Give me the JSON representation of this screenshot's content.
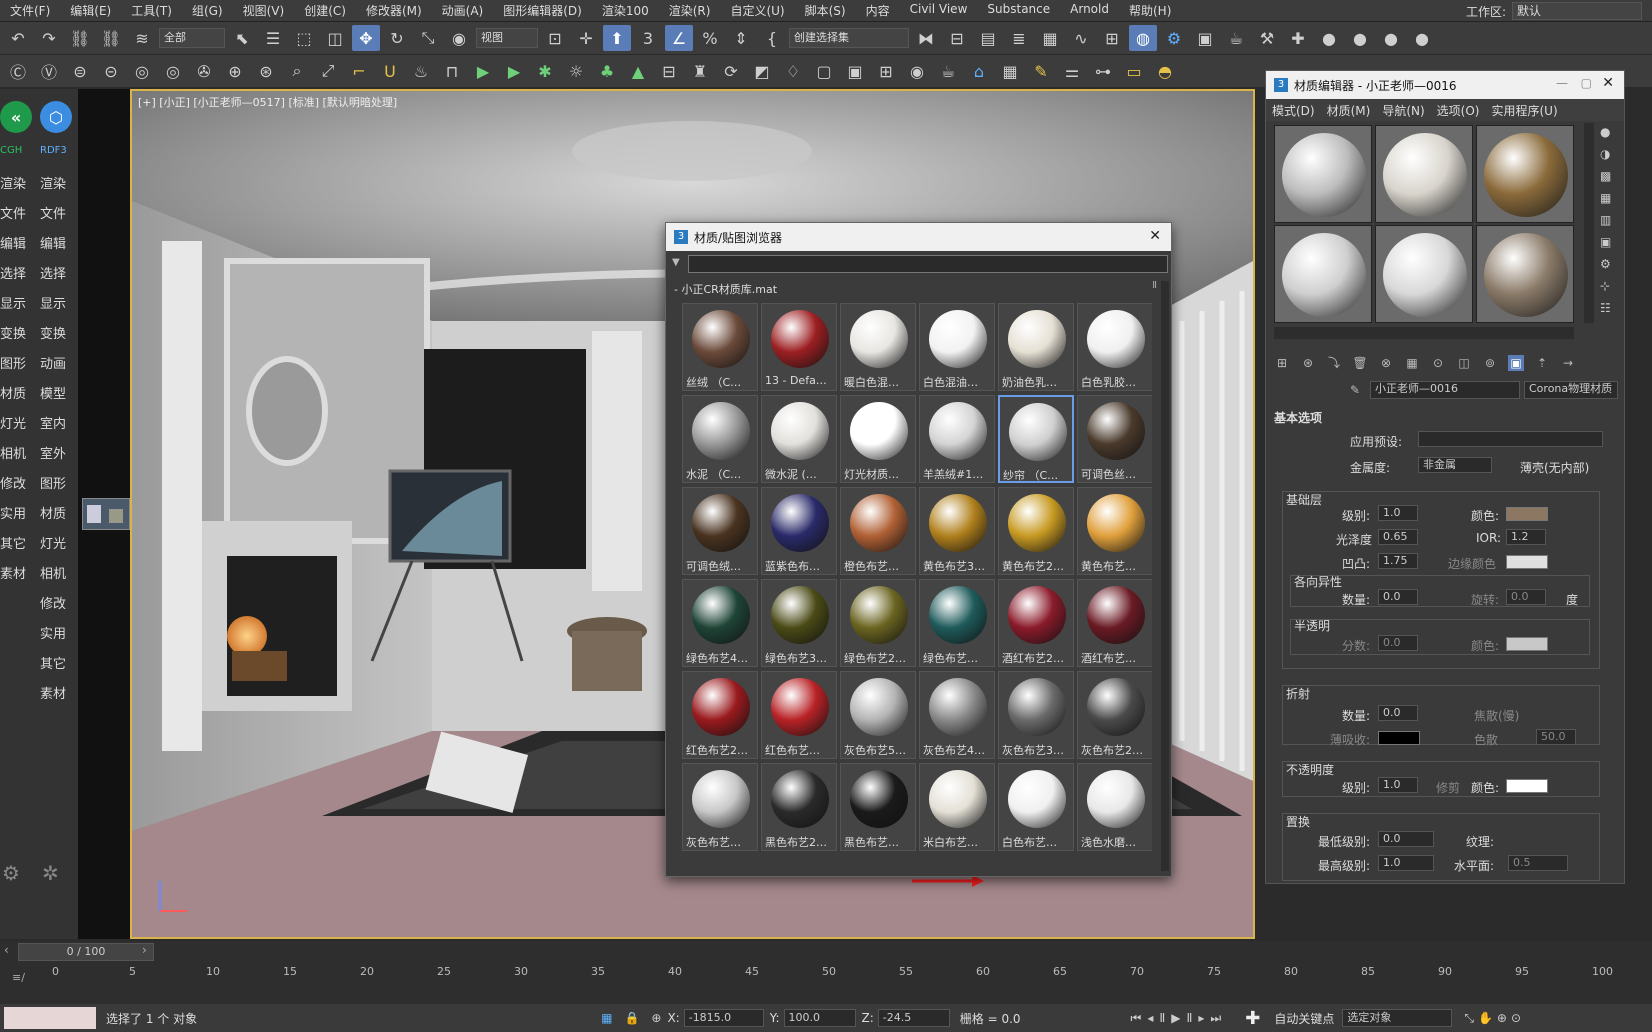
{
  "menus": [
    "文件(F)",
    "编辑(E)",
    "工具(T)",
    "组(G)",
    "视图(V)",
    "创建(C)",
    "修改器(M)",
    "动画(A)",
    "图形编辑器(D)",
    "渲染100",
    "渲染(R)",
    "自定义(U)",
    "脚本(S)",
    "内容",
    "Civil View",
    "Substance",
    "Arnold",
    "帮助(H)"
  ],
  "workspace": {
    "label": "工作区:",
    "value": "默认"
  },
  "toolbar": {
    "filter_select": "全部",
    "view_select": "视图",
    "selection_set": "创建选择集",
    "snap_label": "3"
  },
  "left_panel": {
    "logos": [
      "CGH",
      "RDF3"
    ],
    "col1": [
      "渲染",
      "文件",
      "编辑",
      "选择",
      "显示",
      "变换",
      "图形",
      "材质",
      "灯光",
      "相机",
      "修改",
      "实用",
      "其它",
      "素材"
    ],
    "col2": [
      "渲染",
      "文件",
      "编辑",
      "选择",
      "显示",
      "变换",
      "动画",
      "模型",
      "室内",
      "室外",
      "图形",
      "材质",
      "灯光",
      "相机",
      "修改",
      "实用",
      "其它",
      "素材"
    ]
  },
  "viewport": {
    "label": "[+] [小正] [小正老师—0517] [标准] [默认明暗处理]"
  },
  "browser": {
    "title": "材质/贴图浏览器",
    "library": "- 小正CR材质库.mat",
    "materials": [
      {
        "name": "丝绒 （C…",
        "color": "#6b4a3a"
      },
      {
        "name": "13 - Defa…",
        "color": "#9c1f22"
      },
      {
        "name": "暖白色混…",
        "color": "#e8e6e2"
      },
      {
        "name": "白色混油…",
        "color": "#f2f2f2"
      },
      {
        "name": "奶油色乳…",
        "color": "#e6e0d4"
      },
      {
        "name": "白色乳胶…",
        "color": "#f0f0f0"
      },
      {
        "name": "水泥 （C…",
        "color": "#9a9a9a"
      },
      {
        "name": "微水泥 (…",
        "color": "#e2e0dc"
      },
      {
        "name": "灯光材质…",
        "color": "#ffffff"
      },
      {
        "name": "羊羔绒#1…",
        "color": "#d4d4d4"
      },
      {
        "name": "纱帘 （C…",
        "color": "#cfcfcf"
      },
      {
        "name": "可调色丝…",
        "color": "#4a3a2c"
      },
      {
        "name": "可调色绒…",
        "color": "#4a3320"
      },
      {
        "name": "蓝紫色布…",
        "color": "#2a2a6a"
      },
      {
        "name": "橙色布艺…",
        "color": "#b06034"
      },
      {
        "name": "黄色布艺3…",
        "color": "#b0801c"
      },
      {
        "name": "黄色布艺2…",
        "color": "#c79a22"
      },
      {
        "name": "黄色布艺…",
        "color": "#e0a03c"
      },
      {
        "name": "绿色布艺4…",
        "color": "#1e4436"
      },
      {
        "name": "绿色布艺3…",
        "color": "#4a4a16"
      },
      {
        "name": "绿色布艺2…",
        "color": "#6a6420"
      },
      {
        "name": "绿色布艺…",
        "color": "#1e5a5a"
      },
      {
        "name": "酒红布艺2…",
        "color": "#8a1a2a"
      },
      {
        "name": "酒红布艺…",
        "color": "#6a1a24"
      },
      {
        "name": "红色布艺2…",
        "color": "#9a1a1e"
      },
      {
        "name": "红色布艺…",
        "color": "#b82226"
      },
      {
        "name": "灰色布艺5…",
        "color": "#b4b4b4"
      },
      {
        "name": "灰色布艺4…",
        "color": "#8a8a8a"
      },
      {
        "name": "灰色布艺3…",
        "color": "#6a6a6a"
      },
      {
        "name": "灰色布艺2…",
        "color": "#4a4a4a"
      },
      {
        "name": "灰色布艺…",
        "color": "#c8c8c8"
      },
      {
        "name": "黑色布艺2…",
        "color": "#2a2a2a"
      },
      {
        "name": "黑色布艺…",
        "color": "#1a1a1a"
      },
      {
        "name": "米白布艺…",
        "color": "#e4e0d6"
      },
      {
        "name": "白色布艺…",
        "color": "#f0f0f0"
      },
      {
        "name": "浅色水磨…",
        "color": "#e8e8e8"
      }
    ],
    "selected_index": 10
  },
  "editor": {
    "title": "材质编辑器 - 小正老师—0016",
    "menus": [
      "模式(D)",
      "材质(M)",
      "导航(N)",
      "选项(O)",
      "实用程序(U)"
    ],
    "samples": [
      "#bdbdbd",
      "#d8d4cc",
      "#8a6a3a",
      "#cfcfcf",
      "#d8d8d8",
      "#8a7a68"
    ],
    "material_name": "小正老师—0016",
    "material_type": "Corona物理材质",
    "section_basic": "基本选项",
    "preset_label": "应用预设:",
    "metal_label": "金属度:",
    "metal_value": "非金属",
    "thin_label": "薄壳(无内部)",
    "base_layer": "基础层",
    "level_label": "级别:",
    "level_value": "1.0",
    "color_label": "颜色:",
    "base_color": "#8c7862",
    "gloss_label": "光泽度",
    "gloss_value": "0.65",
    "ior_label": "IOR:",
    "ior_value": "1.2",
    "bump_label": "凹凸:",
    "bump_value": "1.75",
    "edge_color_label": "边缘颜色",
    "aniso": "各向异性",
    "aniso_amount_label": "数量:",
    "aniso_amount": "0.0",
    "rotate_label": "旋转:",
    "rotate_value": "0.0",
    "degree": "度",
    "translucency": "半透明",
    "fraction_label": "分数:",
    "fraction_value": "0.0",
    "trans_color_label": "颜色:",
    "refraction": "折射",
    "refr_amount_label": "数量:",
    "refr_amount": "0.0",
    "caustics": "焦散(慢)",
    "thin_absorb": "薄吸收:",
    "dispersion": "色散",
    "abbe": "50.0",
    "opacity": "不透明度",
    "op_level_label": "级别:",
    "op_level": "1.0",
    "clip": "修剪",
    "op_color_label": "颜色:",
    "displacement": "置换",
    "min_level_label": "最低级别:",
    "min_level": "0.0",
    "texture_label": "纹理:",
    "max_level_label": "最高级别:",
    "max_level": "1.0",
    "water_label": "水平面:",
    "water_value": "0.5"
  },
  "timeline": {
    "frame": "0 / 100",
    "ticks": [
      "0",
      "5",
      "10",
      "15",
      "20",
      "25",
      "30",
      "35",
      "40",
      "45",
      "50",
      "55",
      "60",
      "65",
      "70",
      "75",
      "80",
      "85",
      "90",
      "95",
      "100"
    ]
  },
  "status": {
    "text": "选择了 1 个 对象",
    "x_label": "X:",
    "x": "-1815.0",
    "y_label": "Y:",
    "y": "100.0",
    "z_label": "Z:",
    "z": "-24.5",
    "grid": "栅格 = 0.0",
    "auto_key": "自动关键点",
    "select_obj": "选定对象"
  }
}
